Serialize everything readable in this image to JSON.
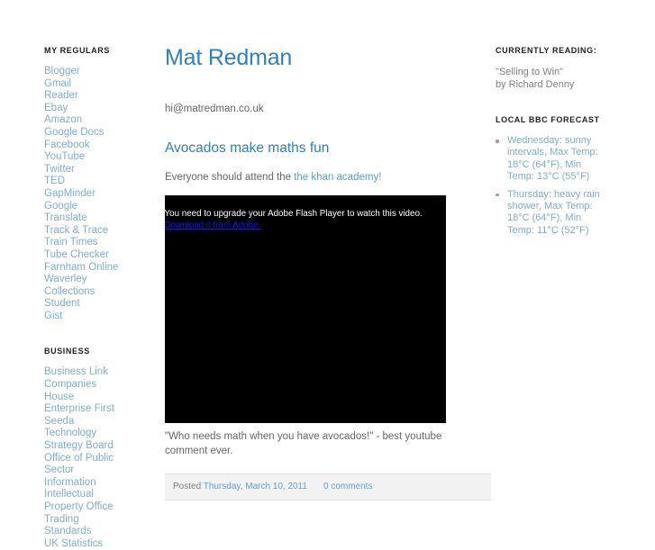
{
  "sidebar_left": {
    "sections": [
      {
        "heading": "MY REGULARS",
        "links": [
          "Blogger",
          "Gmail",
          "Reader",
          "Ebay",
          "Amazon",
          "Google Docs",
          "Facebook",
          "YouTube",
          "Twitter",
          "TED",
          "GapMinder",
          "Google Translate",
          "Track & Trace",
          "Train Times",
          "Tube Checker",
          "Farnham Online",
          "Waverley Collections",
          "Student",
          "Gist"
        ]
      },
      {
        "heading": "BUSINESS",
        "links": [
          "Business Link",
          "Companies House",
          "Enterprise First",
          "Seeda",
          "Technology Strategy Board",
          "Office of Public Sector Information",
          "Intellectual Property Office",
          "Trading Standards",
          "UK Statistics"
        ]
      }
    ]
  },
  "main": {
    "blog_title": "Mat Redman",
    "email": "hi@matredman.co.uk",
    "post": {
      "title": "Avocados make maths fun",
      "intro_before": "Everyone should attend the ",
      "intro_link": "the khan academy",
      "intro_after": "!",
      "video": {
        "message": "You need to upgrade your Adobe Flash Player to watch this video.",
        "download_link": "Download it from Adobe."
      },
      "body": "\"Who needs math when you have avocados!\" - best youtube comment ever.",
      "footer": {
        "posted_label": "Posted",
        "date": "Thursday, March 10, 2011",
        "comments": "0 comments"
      }
    }
  },
  "sidebar_right": {
    "reading": {
      "heading": "CURRENTLY READING:",
      "line1": "\"Selling to Win\"",
      "line2": "by Richard Denny"
    },
    "forecast": {
      "heading": "LOCAL BBC FORECAST",
      "items": [
        "Wednesday: sunny intervals, Max Temp: 18°C (64°F), Min Temp: 13°C (55°F)",
        "Thursday: heavy rain shower, Max Temp: 18°C (64°F), Min Temp: 11°C (52°F)"
      ]
    }
  },
  "colors": {
    "link_blue": "#7fadcd",
    "title_blue": "#2e81bd",
    "accent_blue": "#4f9fd4",
    "body_gray": "#666666",
    "footer_bg": "#f2f2f2"
  }
}
